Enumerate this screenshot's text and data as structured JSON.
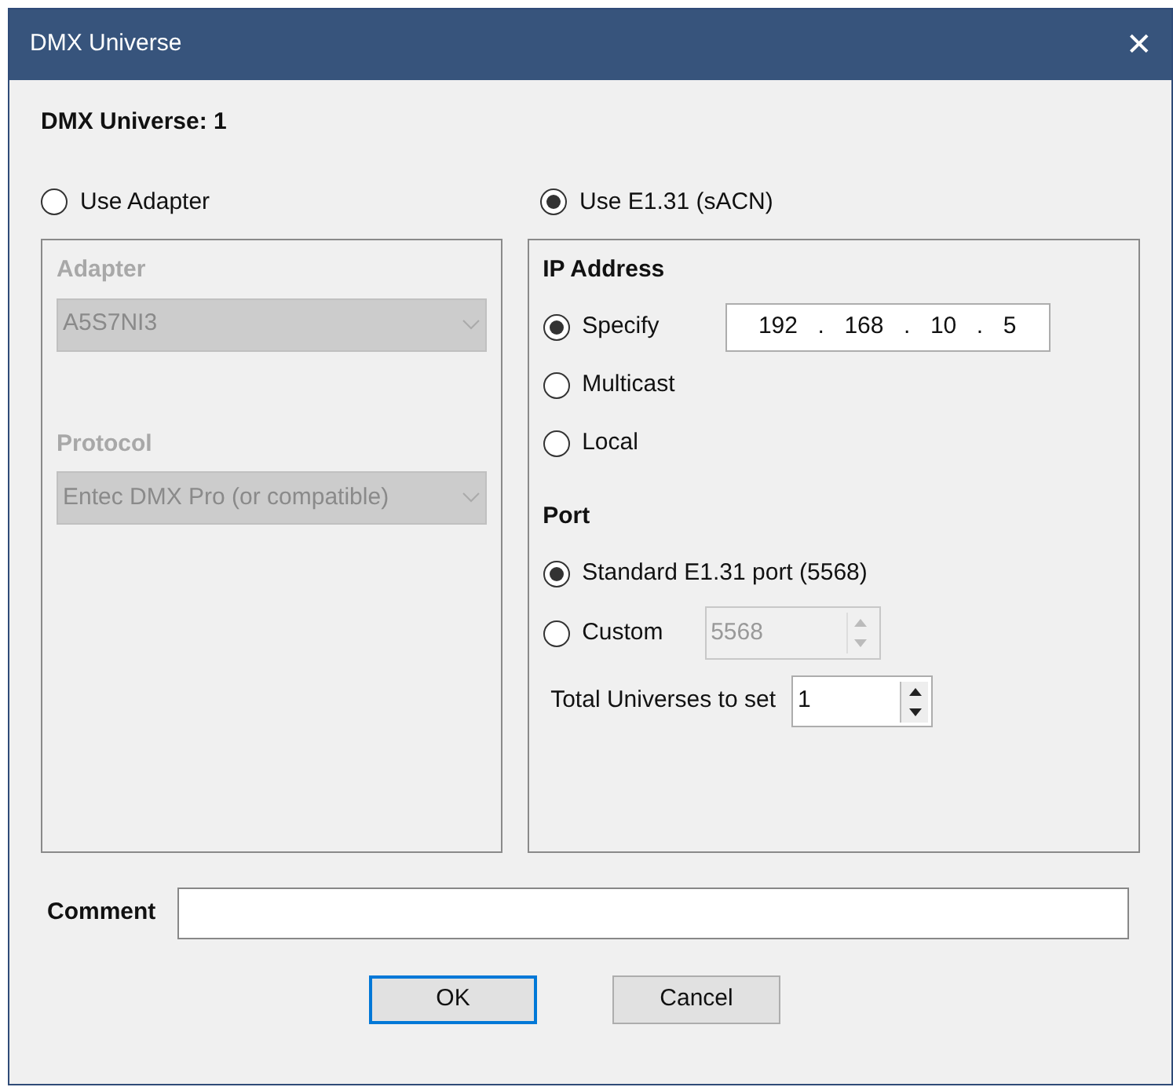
{
  "window": {
    "title": "DMX Universe",
    "close": "✕"
  },
  "header": "DMX Universe: 1",
  "sources": [
    {
      "label": "Use Adapter",
      "selected": false
    },
    {
      "label": "Use E1.31 (sACN)",
      "selected": true
    }
  ],
  "adapter_panel": {
    "disabled": true,
    "fields": [
      {
        "label": "Adapter",
        "value": "A5S7NI3"
      },
      {
        "label": "Protocol",
        "value": "Entec DMX Pro (or compatible)"
      }
    ]
  },
  "ip_address": {
    "heading": "IP Address",
    "options": [
      {
        "label": "Specify",
        "selected": true,
        "kind": "ip"
      },
      {
        "label": "Multicast",
        "selected": false,
        "kind": "plain"
      },
      {
        "label": "Local",
        "selected": false,
        "kind": "plain"
      }
    ],
    "ip_parts": [
      "192",
      ".",
      "168",
      ".",
      "10",
      ".",
      "5"
    ]
  },
  "port": {
    "heading": "Port",
    "options": [
      {
        "label": "Standard E1.31 port (5568)",
        "selected": true,
        "kind": "plain"
      },
      {
        "label": "Custom",
        "selected": false,
        "kind": "spin",
        "value": "5568",
        "disabled": true
      }
    ]
  },
  "total_universes": {
    "label": "Total Universes to set",
    "value": "1"
  },
  "comment": {
    "label": "Comment"
  },
  "buttons": [
    {
      "label": "OK",
      "focused": true
    },
    {
      "label": "Cancel",
      "focused": false
    }
  ]
}
